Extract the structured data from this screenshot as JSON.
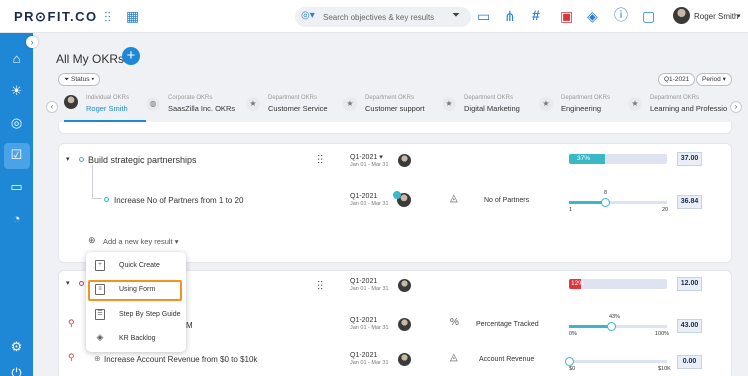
{
  "topbar": {
    "logo": "PR⊙FIT.CO",
    "search_placeholder": "Search objectives & key results",
    "user_name": "Roger Smith",
    "icons": [
      "waveform-icon",
      "grid-icon",
      "target-dropdown-icon",
      "filter-icon",
      "folder-icon",
      "hierarchy-icon",
      "hashtag-icon",
      "youtube-icon",
      "layers-icon",
      "help-icon",
      "chat-icon"
    ]
  },
  "sidebar": {
    "items": [
      "home-icon",
      "bulb-icon",
      "target-icon",
      "calendar-check-icon",
      "message-icon",
      "dashboard-icon",
      "settings-icon",
      "power-icon"
    ]
  },
  "header": {
    "title": "All My OKRs",
    "status_filter": "Status",
    "quarter": "Q1-2021",
    "period": "Period"
  },
  "tabs": [
    {
      "sub": "Individual OKRs",
      "name": "Roger Smith",
      "icon": "avatar"
    },
    {
      "sub": "Corporate OKRs",
      "name": "SaasZilla Inc. OKRs",
      "icon": "globe-icon"
    },
    {
      "sub": "Department OKRs",
      "name": "Customer Service",
      "icon": "star-icon"
    },
    {
      "sub": "Department OKRs",
      "name": "Customer support",
      "icon": "star-icon"
    },
    {
      "sub": "Department OKRs",
      "name": "Digital Marketing",
      "icon": "star-icon"
    },
    {
      "sub": "Department OKRs",
      "name": "Engineering",
      "icon": "star-icon"
    },
    {
      "sub": "Department OKRs",
      "name": "Learning and Professio",
      "icon": "star-icon"
    }
  ],
  "objective1": {
    "title": "Build strategic partnerships",
    "period": "Q1-2021",
    "dates": "Jan 01 - Mar 31",
    "progress_pct": 37,
    "progress_label": "37%",
    "value": "37.00",
    "kr": {
      "title": "Increase No of Partners from 1 to 20",
      "period": "Q1-2021",
      "dates": "Jan 01 - Mar 31",
      "metric": "No of Partners",
      "current": "8",
      "min": "1",
      "max": "20",
      "fill_fraction": 0.37,
      "value": "36.84"
    },
    "add_kr": "Add a new key result"
  },
  "objective2": {
    "period": "Q1-2021",
    "dates": "Jan 01 - Mar 31",
    "progress_pct": 12,
    "progress_label": "12%",
    "value": "12.00",
    "kr1": {
      "title_visible": "M",
      "period": "Q1-2021",
      "dates": "Jan 01 - Mar 31",
      "metric": "Percentage Tracked",
      "current": "43%",
      "min": "0%",
      "max": "100%",
      "fill_fraction": 0.43,
      "value": "43.00"
    },
    "kr2": {
      "title": "Increase Account Revenue from $0 to $10k",
      "period": "Q1-2021",
      "dates": "Jan 01 - Mar 31",
      "metric": "Account Revenue",
      "min": "$0",
      "max": "$10K",
      "fill_fraction": 0.0,
      "value": "0.00"
    }
  },
  "menu": {
    "items": [
      {
        "label": "Quick Create",
        "icon": "plus-square-icon"
      },
      {
        "label": "Using Form",
        "icon": "form-icon"
      },
      {
        "label": "Step By Step Guide",
        "icon": "guide-icon"
      },
      {
        "label": "KR Backlog",
        "icon": "stack-icon"
      }
    ],
    "highlighted": "Using Form",
    "highlight_color": "#f39221"
  },
  "colors": {
    "accent": "#1e88d6",
    "progress": "#3bb8c6",
    "danger": "#d9363e"
  }
}
